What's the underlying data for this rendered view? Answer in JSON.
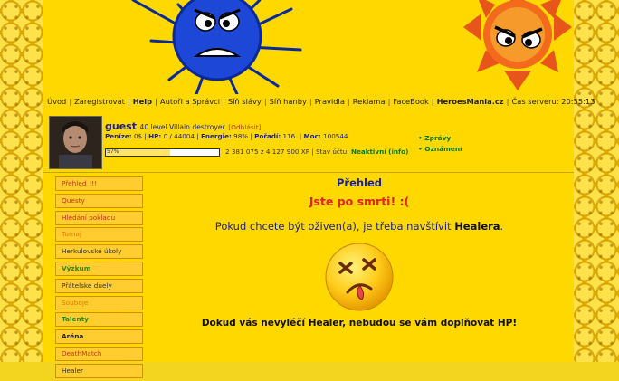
{
  "nav": {
    "items": [
      "Úvod",
      "Zaregistrovat",
      "Help",
      "Autoři a Správci",
      "Síň slávy",
      "Síň hanby",
      "Pravidla",
      "Reklama",
      "FaceBook",
      "HeroesMania.cz"
    ],
    "server_time_label": "Čas serveru: 20:55:13"
  },
  "user": {
    "name": "guest",
    "level": "40 level Villain destroyer",
    "logout": "Odhlásit",
    "stats": {
      "penize_label": "Peníze:",
      "penize": "0$",
      "hp_label": "HP:",
      "hp": "0 / 44004",
      "energie_label": "Energie:",
      "energie": "98%",
      "poradi_label": "Pořadí:",
      "poradi": "116.",
      "moc_label": "Moc:",
      "moc": "100544"
    },
    "xp_percent_text": "57%",
    "xp_progress": 0.57,
    "xp_info": "2 381 075 z 4 127 900 XP | Stav účtu:",
    "account_status": "Neaktivní (info)"
  },
  "links": [
    "Zprávy",
    "Oznámení"
  ],
  "menu": [
    {
      "label": "Přehled",
      "extra": "!!!",
      "cls": "c-red"
    },
    {
      "label": "Questy",
      "cls": "c-red"
    },
    {
      "label": "Hledání pokladu",
      "cls": "c-red"
    },
    {
      "label": "Turnaj",
      "cls": "c-or"
    },
    {
      "label": "Herkulovské úkoly",
      "cls": "c-plain"
    },
    {
      "label": "Výzkum",
      "cls": "c-grn"
    },
    {
      "label": "Přátelské duely",
      "cls": "c-plain"
    },
    {
      "label": "Souboje",
      "cls": "c-or"
    },
    {
      "label": "Talenty",
      "cls": "c-grn"
    },
    {
      "label": "Aréna",
      "cls": "c-blk"
    },
    {
      "label": "DeathMatch",
      "cls": "c-red"
    },
    {
      "label": "Healer",
      "cls": "c-plain"
    }
  ],
  "content": {
    "title": "Přehled",
    "dead": "Jste po smrti! :(",
    "text_before": "Pokud chcete být oživen(a), je třeba navštívit",
    "healer": "Healera",
    "text_after": ".",
    "footer": "Dokud vás nevyléčí Healer, nebudou se vám doplňovat HP!"
  }
}
